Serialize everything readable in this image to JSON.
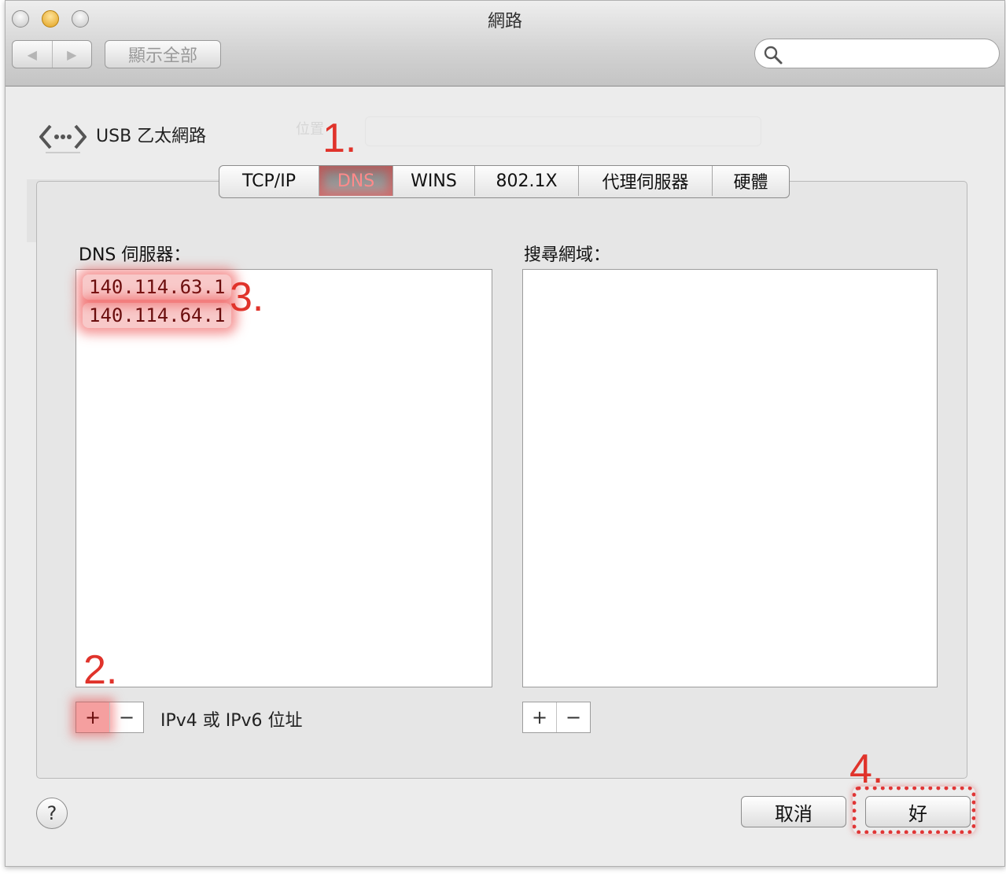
{
  "window": {
    "title": "網路"
  },
  "toolbar": {
    "back_label": "◀",
    "forward_label": "▶",
    "show_all_label": "顯示全部",
    "search_placeholder": ""
  },
  "interface": {
    "name": "USB 乙太網路"
  },
  "tabs": [
    {
      "label": "TCP/IP"
    },
    {
      "label": "DNS",
      "active": true
    },
    {
      "label": "WINS"
    },
    {
      "label": "802.1X"
    },
    {
      "label": "代理伺服器"
    },
    {
      "label": "硬體"
    }
  ],
  "dns": {
    "label": "DNS 伺服器：",
    "servers": [
      "140.114.63.1",
      "140.114.64.1"
    ],
    "add_label": "+",
    "remove_label": "−",
    "hint": "IPv4 或 IPv6 位址"
  },
  "search_domains": {
    "label": "搜尋網域：",
    "add_label": "+",
    "remove_label": "−"
  },
  "steps": {
    "s1": "1.",
    "s2": "2.",
    "s3": "3.",
    "s4": "4."
  },
  "footer": {
    "help_label": "?",
    "cancel_label": "取消",
    "ok_label": "好"
  },
  "colors": {
    "annotation": "#e0332b",
    "active_tab": "#8e8e8e"
  },
  "icons": {
    "search": "search-icon",
    "interface": "ethernet-icon",
    "help": "help-icon"
  }
}
